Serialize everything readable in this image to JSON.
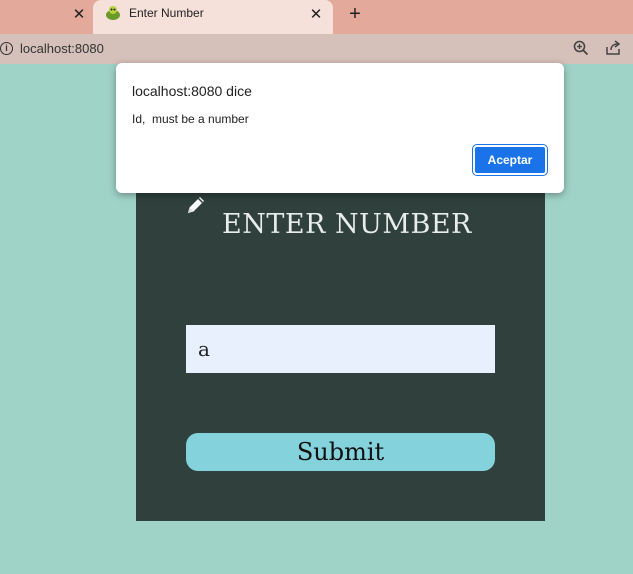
{
  "browser": {
    "tab_title": "Enter Number",
    "prev_tab_close": "✕",
    "tab_close": "✕",
    "new_tab": "+",
    "url": "localhost:8080"
  },
  "page": {
    "title": "ENTER NUMBER",
    "input_value": "a",
    "submit_label": "Submit"
  },
  "alert": {
    "title": "localhost:8080 dice",
    "message": "Id,  must be a number",
    "ok_label": "Aceptar"
  },
  "colors": {
    "page_bg": "#9fd3c7",
    "card_bg": "#2f403d",
    "button_bg": "#83d2dc",
    "accent": "#1a73e8"
  },
  "icons": [
    "info-icon",
    "zoom-icon",
    "share-icon",
    "pencil-icon",
    "favicon-icon"
  ]
}
